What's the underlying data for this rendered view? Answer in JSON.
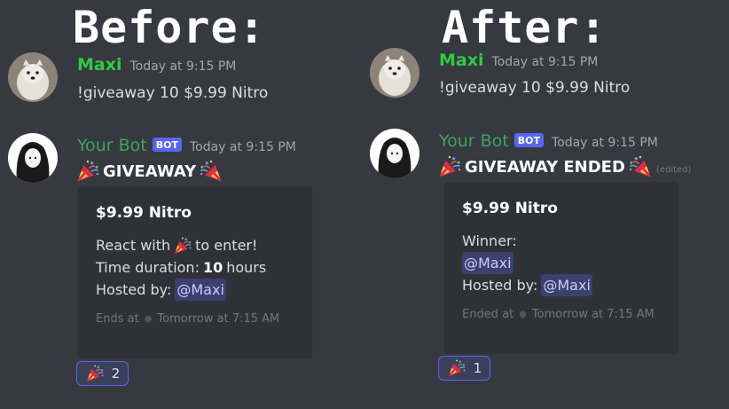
{
  "before": {
    "heading": "Before:",
    "user_message": {
      "username": "Maxi",
      "timestamp": "Today at 9:15 PM",
      "text": "!giveaway 10 $9.99 Nitro"
    },
    "bot_message": {
      "username": "Your Bot",
      "badge": "BOT",
      "timestamp": "Today at 9:15 PM",
      "title": "GIVEAWAY",
      "embed": {
        "title": "$9.99 Nitro",
        "react_prefix": "React with",
        "react_suffix": "to enter!",
        "duration_prefix": "Time duration:",
        "duration_value": "10",
        "duration_suffix": "hours",
        "hosted_label": "Hosted by:",
        "host_mention": "@Maxi",
        "footer_label": "Ends at",
        "footer_time": "Tomorrow at 7:15 AM"
      },
      "reaction": {
        "emoji": "party-popper",
        "count": "2"
      }
    }
  },
  "after": {
    "heading": "After:",
    "user_message": {
      "username": "Maxi",
      "timestamp": "Today at 9:15 PM",
      "text": "!giveaway 10 $9.99 Nitro"
    },
    "bot_message": {
      "username": "Your Bot",
      "badge": "BOT",
      "timestamp": "Today at 9:15 PM",
      "title": "GIVEAWAY ENDED",
      "edited": "(edited)",
      "embed": {
        "title": "$9.99 Nitro",
        "winner_label": "Winner:",
        "winner_mention": "@Maxi",
        "hosted_label": "Hosted by:",
        "host_mention": "@Maxi",
        "footer_label": "Ended at",
        "footer_time": "Tomorrow at 7:15 AM"
      },
      "reaction": {
        "emoji": "party-popper",
        "count": "1"
      }
    }
  },
  "colors": {
    "background": "#36393f",
    "embed_background": "#2f3136",
    "maxi_name": "#2ecc40",
    "bot_name": "#3ba55c",
    "bot_badge": "#5865f2",
    "mention_text": "#c9cdfb"
  }
}
